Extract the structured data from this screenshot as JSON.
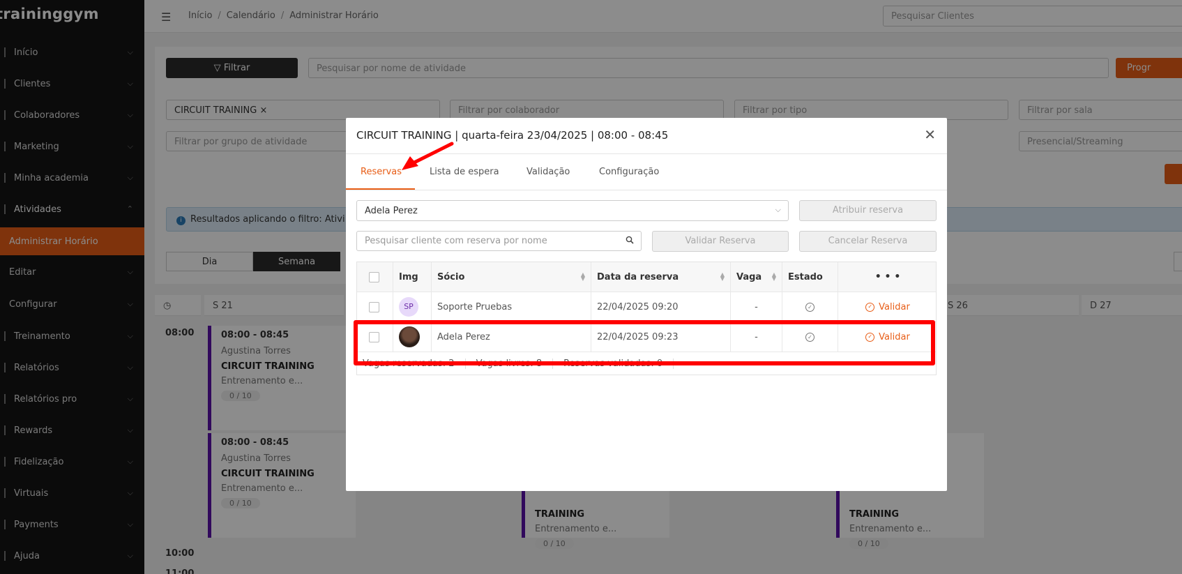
{
  "sidebar": {
    "logo": "traininggym",
    "items": [
      {
        "label": "Início"
      },
      {
        "label": "Clientes"
      },
      {
        "label": "Colaboradores"
      },
      {
        "label": "Marketing"
      },
      {
        "label": "Minha academia"
      },
      {
        "label": "Atividades"
      },
      {
        "label": "Administrar Horário"
      },
      {
        "label": "Editar"
      },
      {
        "label": "Configurar"
      },
      {
        "label": "Treinamento"
      },
      {
        "label": "Relatórios"
      },
      {
        "label": "Relatórios pro"
      },
      {
        "label": "Rewards"
      },
      {
        "label": "Fidelização"
      },
      {
        "label": "Virtuais"
      },
      {
        "label": "Payments"
      },
      {
        "label": "Ajuda"
      }
    ]
  },
  "topbar": {
    "breadcrumb": [
      "Início",
      "Calendário",
      "Administrar Horário"
    ],
    "search_placeholder": "Pesquisar Clientes"
  },
  "background": {
    "filter_button": "Filtrar",
    "activity_search_placeholder": "Pesquisar por nome de atividade",
    "program_button": "Progr",
    "activity_tag": "CIRCUIT TRAINING ×",
    "filter_collaborator": "Filtrar por colaborador",
    "filter_type": "Filtrar por tipo",
    "filter_room": "Filtrar por sala",
    "filter_group": "Filtrar por grupo de atividade",
    "filter_mode": "Presencial/Streaming",
    "info_text": "Resultados aplicando o filtro: Ativi",
    "view_day": "Dia",
    "view_week": "Semana",
    "col_s21": "S 21",
    "col_s26": "S 26",
    "col_d27": "D 27",
    "time_0800": "08:00",
    "time_1000": "10:00",
    "time_1100": "11:00",
    "event_time": "08:00 - 08:45",
    "event_instructor": "Agustina Torres",
    "event_activity": "CIRCUIT TRAINING",
    "event_activity_partial": "TRAINING",
    "event_desc": "Entrenamento e...",
    "event_count": "0 / 10"
  },
  "modal": {
    "title": "CIRCUIT TRAINING | quarta-feira 23/04/2025 | 08:00 - 08:45",
    "tabs": [
      "Reservas",
      "Lista de espera",
      "Validação",
      "Configuração"
    ],
    "active_tab": "Reservas",
    "client_select_value": "Adela Perez",
    "assign_button": "Atribuir reserva",
    "search_placeholder": "Pesquisar cliente com reserva por nome",
    "validate_button": "Validar Reserva",
    "cancel_button": "Cancelar Reserva",
    "columns": [
      "Img",
      "Sócio",
      "Data da reserva",
      "Vaga",
      "Estado",
      "• • •"
    ],
    "rows": [
      {
        "initials": "SP",
        "name": "Soporte Pruebas",
        "date": "22/04/2025 09:20",
        "vaga": "-",
        "action": "Validar"
      },
      {
        "initials": "",
        "name": "Adela Perez",
        "date": "22/04/2025 09:23",
        "vaga": "-",
        "action": "Validar"
      }
    ],
    "stats": {
      "reserved": "Vagas reservadas: 2",
      "free": "Vagas livres: 8",
      "validated": "Reservas validadas: 0"
    }
  },
  "colors": {
    "accent": "#e85d16",
    "event_bar": "#5a12a8",
    "annotation": "#ff0000"
  }
}
